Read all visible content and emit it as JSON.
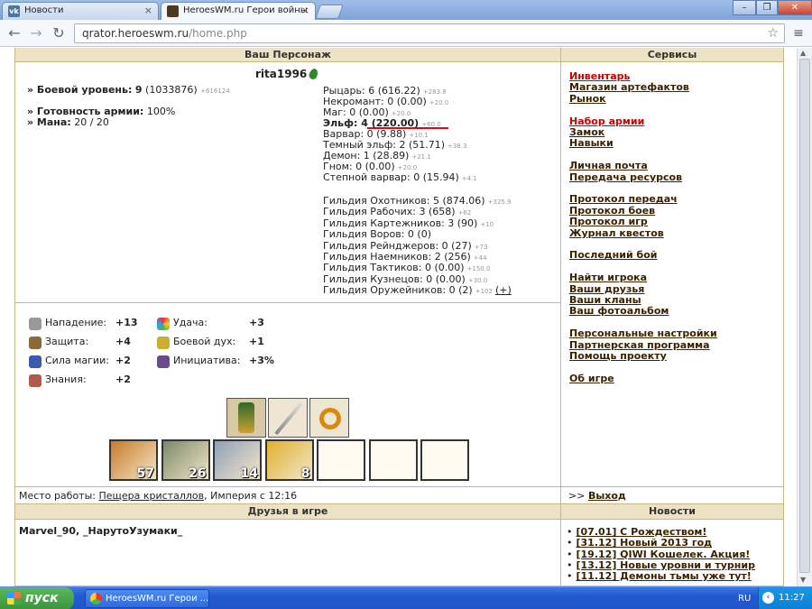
{
  "browser": {
    "tabs": [
      {
        "label": "Новости",
        "active": false
      },
      {
        "label": "HeroesWM.ru Герои войны",
        "active": true
      }
    ],
    "url_host": "qrator.heroeswm.ru",
    "url_path": "/home.php",
    "window_buttons": [
      "–",
      "❐",
      "✕"
    ]
  },
  "character": {
    "header": "Ваш Персонаж",
    "name": "rita1996",
    "combat_level_label": "» Боевой уровень:",
    "combat_level_value": "9",
    "combat_level_exp": "(1033876)",
    "combat_level_delta": "+616124",
    "army_label": "» Готовность армии:",
    "army_value": "100%",
    "mana_label": "» Мана:",
    "mana_value": "20 / 20"
  },
  "factions": [
    {
      "text": "Рыцарь: 6 (616.22)",
      "delta": "+283.8"
    },
    {
      "text": "Некромант: 0 (0.00)",
      "delta": "+20.0"
    },
    {
      "text": "Маг: 0 (0.00)",
      "delta": "+20.0"
    },
    {
      "text": "Эльф: 4 (220.00)",
      "delta": "+60.0",
      "bold": true
    },
    {
      "text": "Варвар: 0 (9.88)",
      "delta": "+10.1"
    },
    {
      "text": "Темный эльф: 2 (51.71)",
      "delta": "+38.3"
    },
    {
      "text": "Демон: 1 (28.89)",
      "delta": "+21.1"
    },
    {
      "text": "Гном: 0 (0.00)",
      "delta": "+20.0"
    },
    {
      "text": "Степной варвар: 0 (15.94)",
      "delta": "+4.1"
    }
  ],
  "guilds": [
    {
      "text": "Гильдия Охотников: 5 (874.06)",
      "delta": "+325.9"
    },
    {
      "text": "Гильдия Рабочих: 3 (658)",
      "delta": "+62"
    },
    {
      "text": "Гильдия Картежников: 3 (90)",
      "delta": "+10"
    },
    {
      "text": "Гильдия Воров: 0 (0)",
      "delta": ""
    },
    {
      "text": "Гильдия Рейнджеров: 0 (27)",
      "delta": "+73"
    },
    {
      "text": "Гильдия Наемников: 2 (256)",
      "delta": "+44"
    },
    {
      "text": "Гильдия Тактиков: 0 (0.00)",
      "delta": "+150.0"
    },
    {
      "text": "Гильдия Кузнецов: 0 (0.00)",
      "delta": "+30.0"
    },
    {
      "text": "Гильдия Оружейников: 0 (2)",
      "delta": "+102",
      "extra": "(+)"
    }
  ],
  "params": [
    {
      "icon": "swords-icon",
      "label": "Нападение:",
      "value": "+13"
    },
    {
      "icon": "shield-icon",
      "label": "Защита:",
      "value": "+4"
    },
    {
      "icon": "wand-icon",
      "label": "Сила магии:",
      "value": "+2"
    },
    {
      "icon": "book-icon",
      "label": "Знания:",
      "value": "+2"
    },
    {
      "icon": "rainbow-icon",
      "label": "Удача:",
      "value": "+3"
    },
    {
      "icon": "morale-icon",
      "label": "Боевой дух:",
      "value": "+1"
    },
    {
      "icon": "initiative-icon",
      "label": "Инициатива:",
      "value": "+3%"
    }
  ],
  "army": [
    {
      "name": "elf-creature",
      "count": "57",
      "color": "#c77b2a"
    },
    {
      "name": "druid-creature",
      "count": "26",
      "color": "#7a8a6a"
    },
    {
      "name": "elf-archer-creature",
      "count": "14",
      "color": "#8fa0b8"
    },
    {
      "name": "sprite-creature",
      "count": "8",
      "color": "#e0b030"
    },
    {
      "name": "empty-slot",
      "count": ""
    },
    {
      "name": "empty-slot",
      "count": ""
    },
    {
      "name": "empty-slot",
      "count": ""
    }
  ],
  "workplace": {
    "prefix": "Место работы:",
    "place": "Пещера кристаллов",
    "suffix": ", Империя с 12:16"
  },
  "exit": {
    "prefix": ">>",
    "label": "Выход"
  },
  "services": {
    "header": "Сервисы",
    "groups": [
      [
        {
          "label": "Инвентарь",
          "red": true
        },
        {
          "label": "Магазин артефактов"
        },
        {
          "label": "Рынок"
        }
      ],
      [
        {
          "label": "Набор армии",
          "red": true
        },
        {
          "label": "Замок"
        },
        {
          "label": "Навыки"
        }
      ],
      [
        {
          "label": "Личная почта"
        },
        {
          "label": "Передача ресурсов"
        }
      ],
      [
        {
          "label": "Протокол передач"
        },
        {
          "label": "Протокол боев"
        },
        {
          "label": "Протокол игр"
        },
        {
          "label": "Журнал квестов"
        }
      ],
      [
        {
          "label": "Последний бой"
        }
      ],
      [
        {
          "label": "Найти игрока"
        },
        {
          "label": "Ваши друзья"
        },
        {
          "label": "Ваши кланы"
        },
        {
          "label": "Ваш фотоальбом"
        }
      ],
      [
        {
          "label": "Персональные настройки"
        },
        {
          "label": "Партнерская программа"
        },
        {
          "label": "Помощь проекту"
        }
      ],
      [
        {
          "label": "Об игре"
        }
      ]
    ]
  },
  "friends": {
    "header": "Друзья в игре",
    "list": "Marvel_90, _НарутоУзумаки_"
  },
  "news": {
    "header": "Новости",
    "items": [
      "[07.01] С Рождеством!",
      "[31.12] Новый 2013 год",
      "[19.12] QIWI Кошелек. Акция!",
      "[13.12] Новые уровни и турнир",
      "[11.12] Демоны тьмы уже тут!"
    ]
  },
  "taskbar": {
    "start": "пуск",
    "task": "HeroesWM.ru Герои ...",
    "lang": "RU",
    "time": "11:27"
  },
  "colors": {
    "frame": "#c9b588",
    "header_bg": "#ede2c4",
    "link": "#3a2200",
    "link_red": "#cc0000"
  }
}
